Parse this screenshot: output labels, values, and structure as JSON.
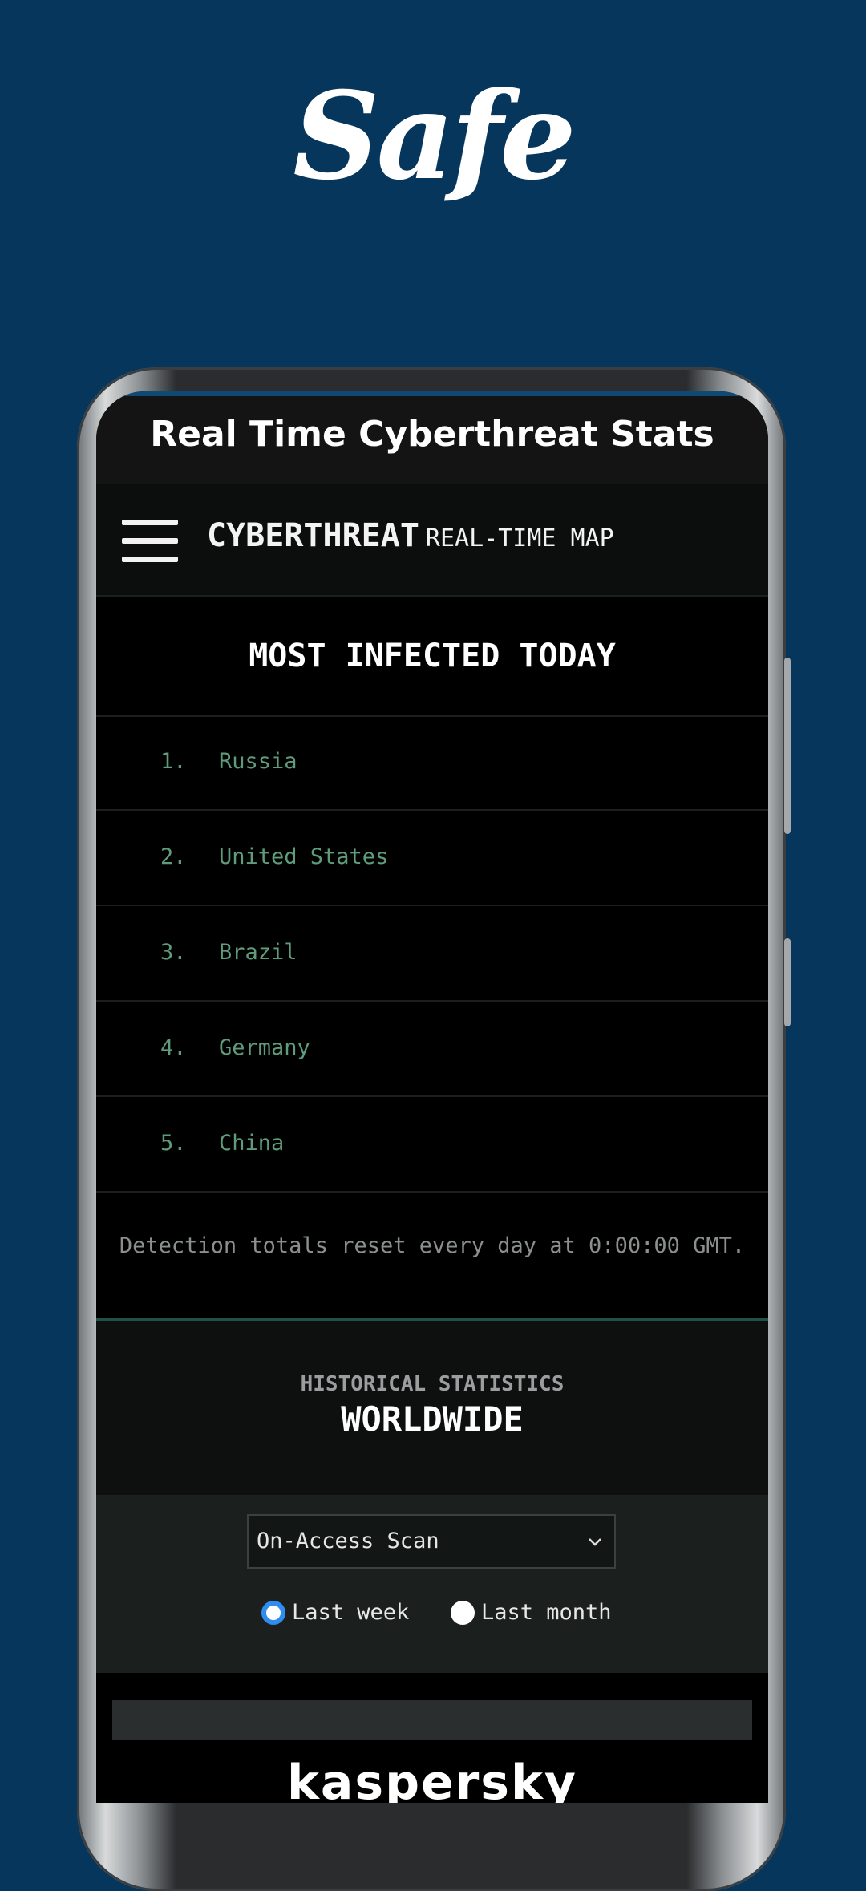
{
  "promo": {
    "logo_text": "Safe"
  },
  "app": {
    "title": "Real Time Cyberthreat Stats",
    "brand_bold": "CYBERTHREAT",
    "brand_light": "REAL-TIME MAP"
  },
  "most_infected": {
    "title": "MOST INFECTED TODAY",
    "items": [
      {
        "rank": "1.",
        "country": "Russia"
      },
      {
        "rank": "2.",
        "country": "United States"
      },
      {
        "rank": "3.",
        "country": "Brazil"
      },
      {
        "rank": "4.",
        "country": "Germany"
      },
      {
        "rank": "5.",
        "country": "China"
      }
    ],
    "note": "Detection totals reset every day at 0:00:00 GMT."
  },
  "historical": {
    "subtitle": "HISTORICAL STATISTICS",
    "title": "WORLDWIDE",
    "select_value": "On-Access Scan",
    "radio_week": "Last week",
    "radio_month": "Last month",
    "selected": "week"
  },
  "footer_brand": "kaspersky",
  "colors": {
    "background": "#06365c",
    "rank_text": "#5f9c7b",
    "radio_selected": "#2f8df0"
  }
}
